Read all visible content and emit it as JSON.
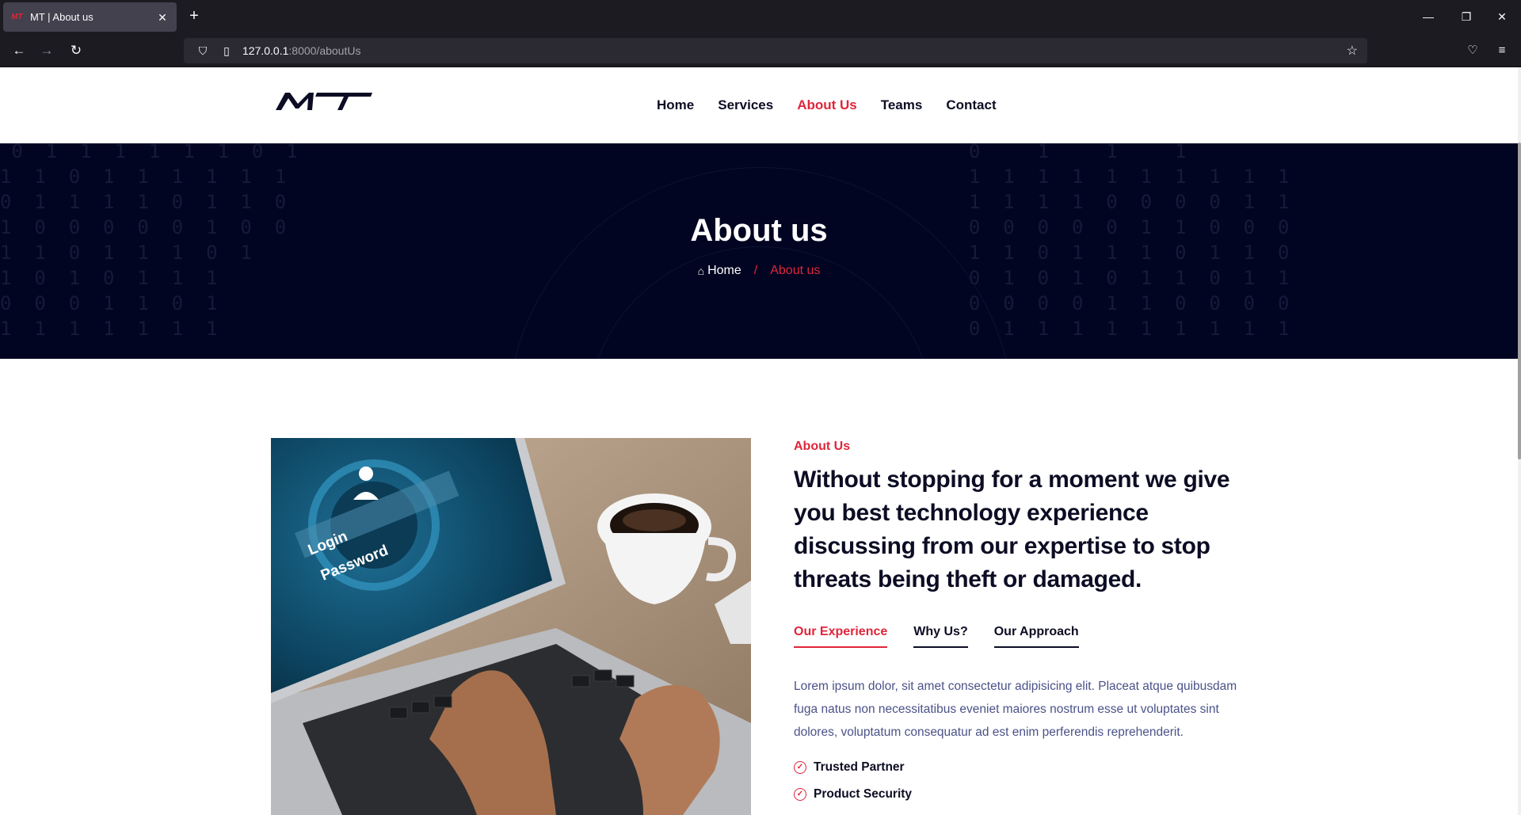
{
  "browser": {
    "tab_title": "MT | About us",
    "tab_favicon": "MT",
    "url_host": "127.0.0.1",
    "url_path": ":8000/aboutUs"
  },
  "site": {
    "logo_text": "MT",
    "nav": [
      {
        "label": "Home"
      },
      {
        "label": "Services"
      },
      {
        "label": "About Us",
        "active": true
      },
      {
        "label": "Teams"
      },
      {
        "label": "Contact"
      }
    ]
  },
  "banner": {
    "title": "About us",
    "breadcrumb_home": "Home",
    "breadcrumb_sep": "/",
    "breadcrumb_current": "About us"
  },
  "about": {
    "subtitle": "About Us",
    "headline": "Without stopping for a moment we give you best technology experience discussing from our expertise to stop threats being theft or damaged.",
    "tabs": [
      {
        "label": "Our Experience",
        "active": true
      },
      {
        "label": "Why Us?"
      },
      {
        "label": "Our Approach"
      }
    ],
    "body": "Lorem ipsum dolor, sit amet consectetur adipisicing elit. Placeat atque quibusdam fuga natus non necessitatibus eveniet maiores nostrum esse ut voluptates sint dolores, voluptatum consequatur ad est enim perferendis reprehenderit.",
    "features": [
      "Trusted Partner",
      "Product Security"
    ]
  },
  "image": {
    "screen_text_1": "Login",
    "screen_text_2": "Password"
  },
  "colors": {
    "accent": "#e0253a",
    "dark": "#0c0d24",
    "banner": "#020522"
  }
}
